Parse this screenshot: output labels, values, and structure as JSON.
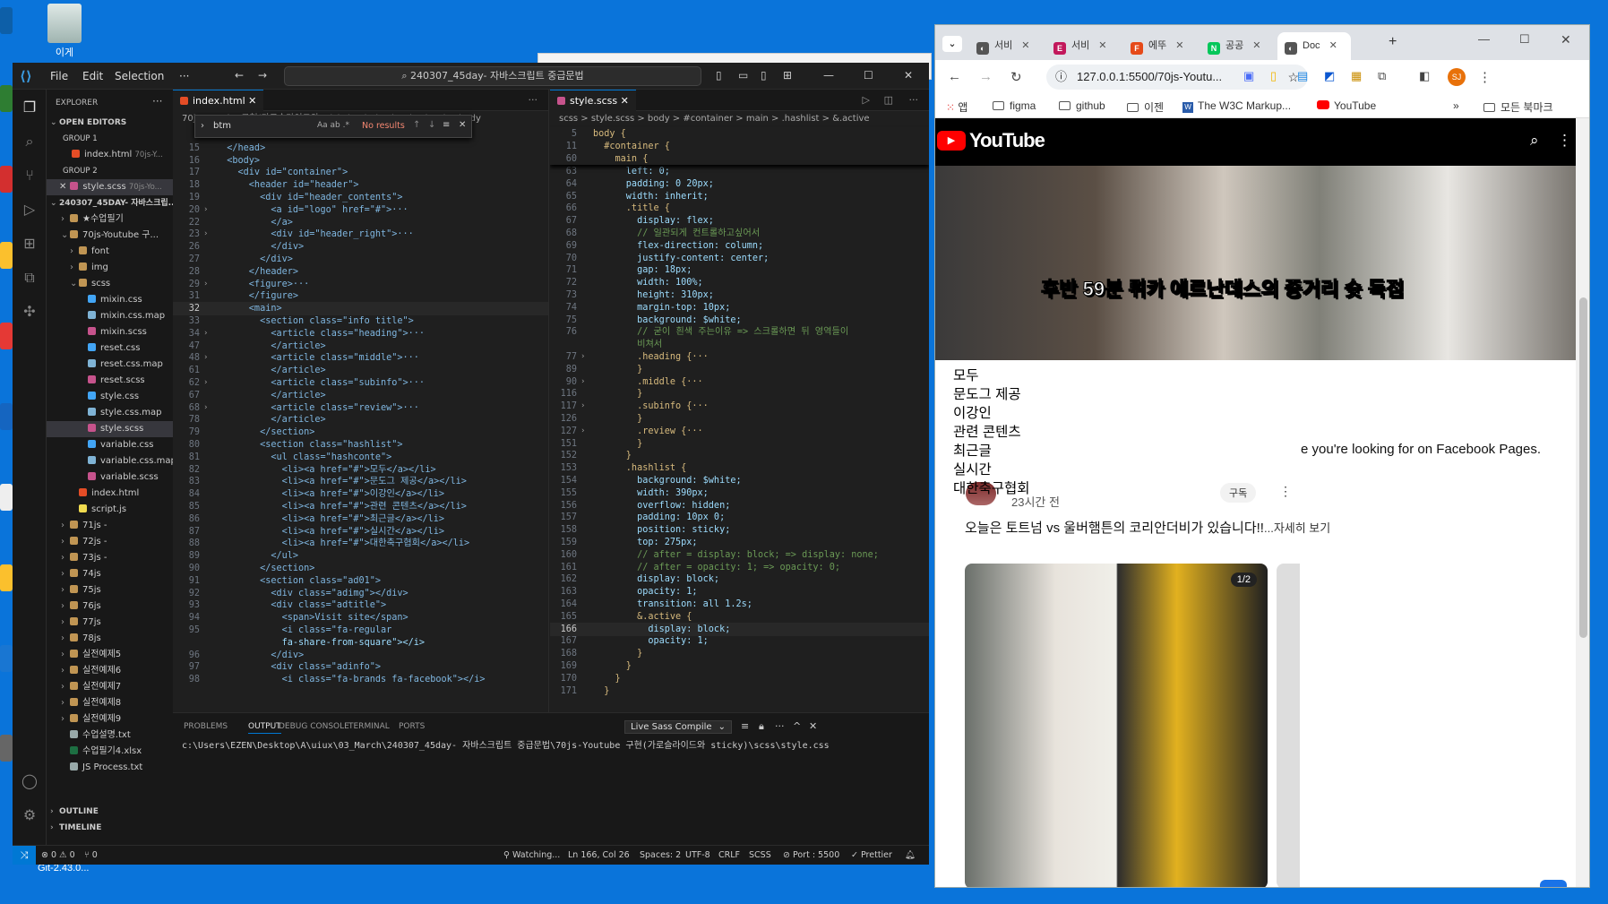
{
  "desktop": {
    "top_icon_label": "이게",
    "taskbar_label": "Git-2.43.0..."
  },
  "vscode": {
    "menu": [
      "File",
      "Edit",
      "Selection"
    ],
    "command_center": "240307_45day- 자바스크립트 중급문법",
    "explorer_title": "EXPLORER",
    "open_editors": "OPEN EDITORS",
    "group1": "GROUP 1",
    "group1_file": "index.html",
    "group1_path": "70js-Y...",
    "group2": "GROUP 2",
    "group2_file": "style.scss",
    "group2_path": "70js-Yo...",
    "project_root": "240307_45DAY- 자바스크립...",
    "tree": [
      {
        "label": "★수업필기",
        "kind": "folder",
        "indent": 1,
        "open": false
      },
      {
        "label": "70js-Youtube 구...",
        "kind": "folder",
        "indent": 1,
        "open": true
      },
      {
        "label": "font",
        "kind": "folder",
        "indent": 2,
        "open": false
      },
      {
        "label": "img",
        "kind": "folder",
        "indent": 2,
        "open": false
      },
      {
        "label": "scss",
        "kind": "folder",
        "indent": 2,
        "open": true
      },
      {
        "label": "mixin.css",
        "kind": "css",
        "indent": 3
      },
      {
        "label": "mixin.css.map",
        "kind": "map",
        "indent": 3
      },
      {
        "label": "mixin.scss",
        "kind": "scss",
        "indent": 3
      },
      {
        "label": "reset.css",
        "kind": "css",
        "indent": 3
      },
      {
        "label": "reset.css.map",
        "kind": "map",
        "indent": 3
      },
      {
        "label": "reset.scss",
        "kind": "scss",
        "indent": 3
      },
      {
        "label": "style.css",
        "kind": "css",
        "indent": 3
      },
      {
        "label": "style.css.map",
        "kind": "map",
        "indent": 3
      },
      {
        "label": "style.scss",
        "kind": "scss",
        "indent": 3,
        "selected": true
      },
      {
        "label": "variable.css",
        "kind": "css",
        "indent": 3
      },
      {
        "label": "variable.css.map",
        "kind": "map",
        "indent": 3
      },
      {
        "label": "variable.scss",
        "kind": "scss",
        "indent": 3
      },
      {
        "label": "index.html",
        "kind": "html",
        "indent": 2
      },
      {
        "label": "script.js",
        "kind": "js",
        "indent": 2
      },
      {
        "label": "71js -",
        "kind": "folder",
        "indent": 1,
        "open": false
      },
      {
        "label": "72js -",
        "kind": "folder",
        "indent": 1,
        "open": false
      },
      {
        "label": "73js -",
        "kind": "folder",
        "indent": 1,
        "open": false
      },
      {
        "label": "74js",
        "kind": "folder",
        "indent": 1,
        "open": false
      },
      {
        "label": "75js",
        "kind": "folder",
        "indent": 1,
        "open": false
      },
      {
        "label": "76js",
        "kind": "folder",
        "indent": 1,
        "open": false
      },
      {
        "label": "77js",
        "kind": "folder",
        "indent": 1,
        "open": false
      },
      {
        "label": "78js",
        "kind": "folder",
        "indent": 1,
        "open": false
      },
      {
        "label": "실전예제5",
        "kind": "folder",
        "indent": 1,
        "open": false
      },
      {
        "label": "실전예제6",
        "kind": "folder",
        "indent": 1,
        "open": false
      },
      {
        "label": "실전예제7",
        "kind": "folder",
        "indent": 1,
        "open": false
      },
      {
        "label": "실전예제8",
        "kind": "folder",
        "indent": 1,
        "open": false
      },
      {
        "label": "실전예제9",
        "kind": "folder",
        "indent": 1,
        "open": false
      },
      {
        "label": "수업설명.txt",
        "kind": "txt",
        "indent": 1
      },
      {
        "label": "수업필기4.xlsx",
        "kind": "xlsx",
        "indent": 1
      },
      {
        "label": "JS Process.txt",
        "kind": "txt",
        "indent": 1
      }
    ],
    "outline": "OUTLINE",
    "timeline": "TIMELINE",
    "left_editor": {
      "tab": "index.html",
      "breadcrumb": "70js-Youtube 구현(가로슬라이드와 sticky) > index.html > html > body",
      "find_query": "btm",
      "find_result": "No results",
      "lines": [
        {
          "n": "2",
          "t": ""
        },
        {
          "n": "15",
          "t": "  </head>"
        },
        {
          "n": "16",
          "t": "  <body>"
        },
        {
          "n": "17",
          "t": "    <div id=\"container\">"
        },
        {
          "n": "18",
          "t": "      <header id=\"header\">"
        },
        {
          "n": "19",
          "t": "        <div id=\"header_contents\">"
        },
        {
          "n": "20",
          "t": "          <a id=\"logo\" href=\"#\">···",
          "f": true
        },
        {
          "n": "22",
          "t": "          </a>"
        },
        {
          "n": "23",
          "t": "          <div id=\"header_right\">···",
          "f": true
        },
        {
          "n": "26",
          "t": "          </div>"
        },
        {
          "n": "27",
          "t": "        </div>"
        },
        {
          "n": "28",
          "t": "      </header>"
        },
        {
          "n": "29",
          "t": "      <figure>···",
          "f": true
        },
        {
          "n": "31",
          "t": "      </figure>"
        },
        {
          "n": "32",
          "t": "      <main>",
          "cur": true
        },
        {
          "n": "33",
          "t": "        <section class=\"info title\">"
        },
        {
          "n": "34",
          "t": "          <article class=\"heading\">···",
          "f": true
        },
        {
          "n": "47",
          "t": "          </article>"
        },
        {
          "n": "48",
          "t": "          <article class=\"middle\">···",
          "f": true
        },
        {
          "n": "61",
          "t": "          </article>"
        },
        {
          "n": "62",
          "t": "          <article class=\"subinfo\">···",
          "f": true
        },
        {
          "n": "67",
          "t": "          </article>"
        },
        {
          "n": "68",
          "t": "          <article class=\"review\">···",
          "f": true
        },
        {
          "n": "78",
          "t": "          </article>"
        },
        {
          "n": "79",
          "t": "        </section>"
        },
        {
          "n": "80",
          "t": "        <section class=\"hashlist\">"
        },
        {
          "n": "81",
          "t": "          <ul class=\"hashconte\">"
        },
        {
          "n": "82",
          "t": "            <li><a href=\"#\">모두</a></li>"
        },
        {
          "n": "83",
          "t": "            <li><a href=\"#\">문도그 제공</a></li>"
        },
        {
          "n": "84",
          "t": "            <li><a href=\"#\">이강인</a></li>"
        },
        {
          "n": "85",
          "t": "            <li><a href=\"#\">관련 콘텐츠</a></li>"
        },
        {
          "n": "86",
          "t": "            <li><a href=\"#\">최근글</a></li>"
        },
        {
          "n": "87",
          "t": "            <li><a href=\"#\">실시간</a></li>"
        },
        {
          "n": "88",
          "t": "            <li><a href=\"#\">대한축구협회</a></li>"
        },
        {
          "n": "89",
          "t": "          </ul>"
        },
        {
          "n": "90",
          "t": "        </section>"
        },
        {
          "n": "91",
          "t": "        <section class=\"ad01\">"
        },
        {
          "n": "92",
          "t": "          <div class=\"adimg\"></div>"
        },
        {
          "n": "93",
          "t": "          <div class=\"adtitle\">"
        },
        {
          "n": "94",
          "t": "            <span>Visit site</span>"
        },
        {
          "n": "95",
          "t": "            <i class=\"fa-regular"
        },
        {
          "n": "",
          "t": "            fa-share-from-square\"></i>"
        },
        {
          "n": "96",
          "t": "          </div>"
        },
        {
          "n": "97",
          "t": "          <div class=\"adinfo\">"
        },
        {
          "n": "98",
          "t": "            <i class=\"fa-brands fa-facebook\"></i>"
        }
      ]
    },
    "right_editor": {
      "tab": "style.scss",
      "breadcrumb": "scss > style.scss > body > #container > main > .hashlist > &.active",
      "sticky": [
        {
          "n": "5",
          "t": "body {"
        },
        {
          "n": "11",
          "t": "  #container {"
        },
        {
          "n": "60",
          "t": "    main {"
        }
      ],
      "lines": [
        {
          "n": "63",
          "t": "      left: 0;"
        },
        {
          "n": "64",
          "t": "      padding: 0 20px;"
        },
        {
          "n": "65",
          "t": "      width: inherit;"
        },
        {
          "n": "66",
          "t": "      .title {"
        },
        {
          "n": "67",
          "t": "        display: flex;"
        },
        {
          "n": "68",
          "t": "        // 일관되게 컨트롤하고싶어서"
        },
        {
          "n": "69",
          "t": "        flex-direction: column;"
        },
        {
          "n": "70",
          "t": "        justify-content: center;"
        },
        {
          "n": "71",
          "t": "        gap: 18px;"
        },
        {
          "n": "72",
          "t": "        width: 100%;"
        },
        {
          "n": "73",
          "t": "        height: 310px;"
        },
        {
          "n": "74",
          "t": "        margin-top: 10px;"
        },
        {
          "n": "75",
          "t": "        background: $white;"
        },
        {
          "n": "76",
          "t": "        // 굳이 흰색 주는이유 => 스크롤하면 뒤 영역들이"
        },
        {
          "n": "",
          "t": "        비쳐서"
        },
        {
          "n": "77",
          "t": "        .heading {···",
          "f": true
        },
        {
          "n": "89",
          "t": "        }"
        },
        {
          "n": "90",
          "t": "        .middle {···",
          "f": true
        },
        {
          "n": "116",
          "t": "        }"
        },
        {
          "n": "117",
          "t": "        .subinfo {···",
          "f": true
        },
        {
          "n": "126",
          "t": "        }"
        },
        {
          "n": "127",
          "t": "        .review {···",
          "f": true
        },
        {
          "n": "151",
          "t": "        }"
        },
        {
          "n": "152",
          "t": "      }"
        },
        {
          "n": "153",
          "t": "      .hashlist {"
        },
        {
          "n": "154",
          "t": "        background: $white;"
        },
        {
          "n": "155",
          "t": "        width: 390px;"
        },
        {
          "n": "156",
          "t": "        overflow: hidden;"
        },
        {
          "n": "157",
          "t": "        padding: 10px 0;"
        },
        {
          "n": "158",
          "t": "        position: sticky;"
        },
        {
          "n": "159",
          "t": "        top: 275px;"
        },
        {
          "n": "160",
          "t": "        // after = display: block; => display: none;"
        },
        {
          "n": "161",
          "t": "        // after = opacity: 1; => opacity: 0;"
        },
        {
          "n": "162",
          "t": "        display: block;"
        },
        {
          "n": "163",
          "t": "        opacity: 1;"
        },
        {
          "n": "164",
          "t": "        transition: all 1.2s;"
        },
        {
          "n": "165",
          "t": "        &.active {"
        },
        {
          "n": "166",
          "t": "          display: block;",
          "cur": true
        },
        {
          "n": "167",
          "t": "          opacity: 1;"
        },
        {
          "n": "168",
          "t": "        }"
        },
        {
          "n": "169",
          "t": "      }"
        },
        {
          "n": "170",
          "t": "    }"
        },
        {
          "n": "171",
          "t": "  }"
        }
      ]
    },
    "panel": {
      "tabs": [
        "PROBLEMS",
        "OUTPUT",
        "DEBUG CONSOLE",
        "TERMINAL",
        "PORTS"
      ],
      "active_tab": "OUTPUT",
      "channel": "Live Sass Compile",
      "output": "c:\\Users\\EZEN\\Desktop\\A\\uiux\\03_March\\240307_45day- 자바스크립트 중급문법\\70js-Youtube 구현(가로슬라이드와 sticky)\\scss\\style.css"
    },
    "status": {
      "errors": "0",
      "warnings": "0",
      "ports": "0",
      "watching": "Watching...",
      "position": "Ln 166, Col 26",
      "spaces": "Spaces: 2",
      "encoding": "UTF-8",
      "eol": "CRLF",
      "language": "SCSS",
      "port": "Port : 5500",
      "prettier": "Prettier"
    }
  },
  "chrome": {
    "tabs": [
      {
        "label": "서비",
        "color": "#555",
        "glyph": "◐"
      },
      {
        "label": "서비",
        "color": "#c2185b",
        "glyph": "E"
      },
      {
        "label": "에뚜",
        "color": "#e64a19",
        "glyph": "F"
      },
      {
        "label": "공공",
        "color": "#03c75a",
        "glyph": "N"
      },
      {
        "label": "Doc",
        "color": "#555",
        "glyph": "◐",
        "active": true
      }
    ],
    "url": "127.0.0.1:5500/70js-Youtu...",
    "profile_initials": "SJ",
    "bookmarks": [
      "앱",
      "figma",
      "github",
      "이젠",
      "The W3C Markup...",
      "YouTube"
    ],
    "all_bookmarks": "모든 북마크",
    "page": {
      "brand": "YouTube",
      "video_caption": "후반 59분 뤼카 에르난데스의 중거리 슛 득점",
      "hashlist": [
        "모두",
        "문도그 제공",
        "이강인",
        "관련 콘텐츠",
        "최근글",
        "실시간",
        "대한축구협회"
      ],
      "facebook_text": "e you're looking for on Facebook Pages.",
      "post_time": "23시간 전",
      "subscribe": "구독",
      "post_text": "오늘은 토트넘 vs 울버햄튼의 코리안더비가 있습니다!!",
      "post_more": "...자세히 보기",
      "photo_badge": "1/2"
    }
  }
}
